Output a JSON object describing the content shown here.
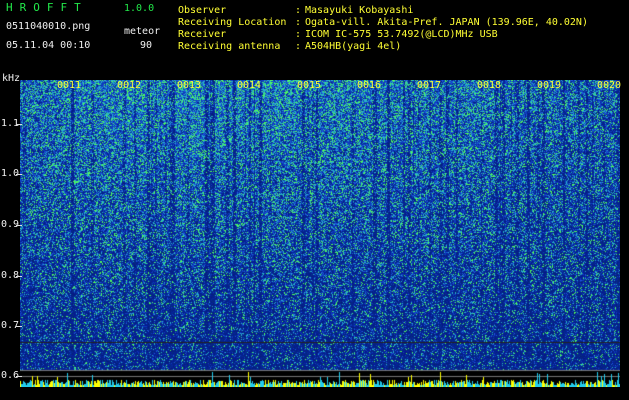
{
  "header": {
    "app_title": "HROFFT",
    "app_version": "1.0.0",
    "file_name": "0511040010.png",
    "mode": "meteor",
    "datetime": "05.11.04 00:10",
    "count": "90"
  },
  "info": {
    "rows": [
      {
        "label": "Observer",
        "value": "Masayuki Kobayashi"
      },
      {
        "label": "Receiving Location",
        "value": "Ogata-vill. Akita-Pref. JAPAN (139.96E, 40.02N)"
      },
      {
        "label": "Receiver",
        "value": "ICOM IC-575 53.7492(@LCD)MHz USB"
      },
      {
        "label": "Receiving antenna",
        "value": "A504HB(yagi 4el)"
      }
    ],
    "separator": ":"
  },
  "axis": {
    "y_unit": "kHz",
    "y_ticks": [
      "1.1",
      "1.0",
      "0.9",
      "0.8",
      "0.7",
      "0.6"
    ],
    "time_ticks": [
      "0011",
      "0012",
      "0013",
      "0014",
      "0015",
      "0016",
      "0017",
      "0018",
      "0019",
      "0020"
    ]
  },
  "colors": {
    "header_green": "#22e84a",
    "label_yellow": "#ffff33",
    "text_white": "#f0f0f0",
    "background_blue": "#0a1f8c",
    "noise_cyan": "#28b4c8",
    "noise_green": "#50ff50",
    "signal_yellow": "#ffff00"
  }
}
